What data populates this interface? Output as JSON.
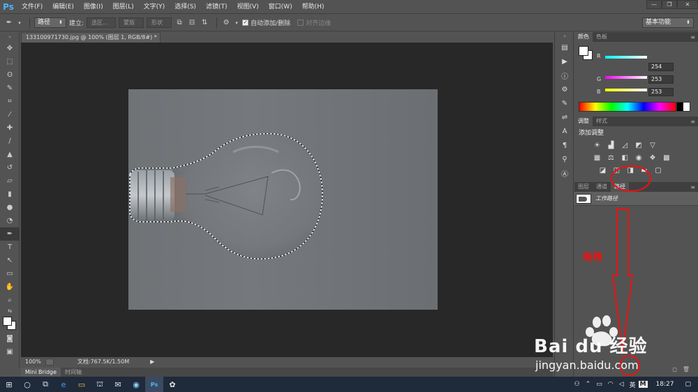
{
  "app": {
    "logo": "Ps",
    "accent": "#4fb4f5"
  },
  "menu": [
    "文件(F)",
    "编辑(E)",
    "图像(I)",
    "图层(L)",
    "文字(Y)",
    "选择(S)",
    "滤镜(T)",
    "视图(V)",
    "窗口(W)",
    "帮助(H)"
  ],
  "window_controls": {
    "minimize": "—",
    "restore": "❐",
    "close": "✕"
  },
  "options": {
    "mode_select": "路径",
    "make_label": "建立:",
    "selection_btn": "选区...",
    "mask_btn": "蒙版",
    "shape_btn": "形状",
    "auto_add_label": "自动添加/删除",
    "align_edges_label": "对齐边缘",
    "workspace": "基本功能"
  },
  "document": {
    "tab_title": "133100971730.jpg @ 100% (图层 1, RGB/8#) *",
    "close": "×"
  },
  "status": {
    "zoom": "100%",
    "doc_info": "文档:767.5K/1.50M"
  },
  "bottom_tabs": [
    "Mini Bridge",
    "时间轴"
  ],
  "color_panel": {
    "tabs": [
      "颜色",
      "色板"
    ],
    "channels": [
      {
        "label": "R",
        "value": "254",
        "color": "#ff5a5a"
      },
      {
        "label": "G",
        "value": "253",
        "color": "#ff40ff"
      },
      {
        "label": "B",
        "value": "253",
        "color": "#ffff40"
      }
    ]
  },
  "adjust_panel": {
    "tabs": [
      "调整",
      "样式"
    ],
    "title": "添加调整"
  },
  "layers_panel": {
    "tabs": [
      "图层",
      "通道",
      "路径"
    ],
    "path_item": "工作路径"
  },
  "annotation": {
    "drag_label": "拖拽",
    "color": "#e11111"
  },
  "watermark": {
    "brand": "Bai du 经验",
    "url": "jingyan.baidu.com"
  },
  "taskbar": {
    "lang": "英",
    "ime": "M",
    "time": "18:27"
  }
}
